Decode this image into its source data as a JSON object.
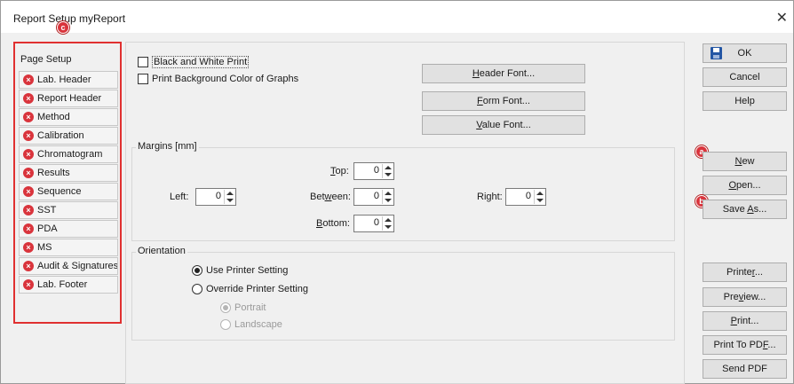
{
  "window": {
    "title": "Report Setup myReport",
    "close_glyph": "✕"
  },
  "nav": {
    "header": "Page Setup",
    "items": [
      {
        "label": "Lab. Header"
      },
      {
        "label": "Report Header"
      },
      {
        "label": "Method"
      },
      {
        "label": "Calibration"
      },
      {
        "label": "Chromatogram"
      },
      {
        "label": "Results"
      },
      {
        "label": "Sequence"
      },
      {
        "label": "SST"
      },
      {
        "label": "PDA"
      },
      {
        "label": "MS"
      },
      {
        "label": "Audit & Signatures"
      },
      {
        "label": "Lab. Footer"
      }
    ],
    "item_icon": "x-circle-icon"
  },
  "callouts": {
    "a": "a",
    "b": "b",
    "c": "c"
  },
  "options": {
    "bw_print": {
      "label": "Black and White Print",
      "checked": false
    },
    "bg_color": {
      "label": "Print Background Color of Graphs",
      "checked": false
    }
  },
  "font_buttons": {
    "header": {
      "u": "H",
      "rest": "eader Font..."
    },
    "form": {
      "u": "F",
      "rest": "orm Font..."
    },
    "value": {
      "u": "V",
      "rest": "alue Font..."
    }
  },
  "margins": {
    "label": "Margins [mm]",
    "top": {
      "u": "T",
      "rest": "op:",
      "value": "0"
    },
    "left": {
      "label": "Left:",
      "value": "0"
    },
    "between": {
      "pre": "Bet",
      "u": "w",
      "rest": "een:",
      "value": "0"
    },
    "right": {
      "label": "Right:",
      "value": "0"
    },
    "bottom": {
      "u": "B",
      "rest": "ottom:",
      "value": "0"
    }
  },
  "orientation": {
    "label": "Orientation",
    "use_printer": "Use Printer Setting",
    "override": "Override Printer Setting",
    "portrait": "Portrait",
    "landscape": "Landscape"
  },
  "right_buttons": {
    "ok": "OK",
    "cancel": "Cancel",
    "help": "Help",
    "new": {
      "u": "N",
      "rest": "ew"
    },
    "open": {
      "u": "O",
      "rest": "pen..."
    },
    "saveas": {
      "pre": "Save ",
      "u": "A",
      "rest": "s..."
    },
    "printer": {
      "pre": "Printe",
      "u": "r",
      "rest": "..."
    },
    "preview": {
      "pre": "Pre",
      "u": "v",
      "rest": "iew..."
    },
    "print": {
      "u": "P",
      "rest": "rint..."
    },
    "print_pdf": {
      "pre": "Print To PD",
      "u": "F",
      "rest": "..."
    },
    "send_pdf": "Send PDF"
  },
  "colors": {
    "accent_red": "#d9343c",
    "save_icon": "#2456a4"
  }
}
